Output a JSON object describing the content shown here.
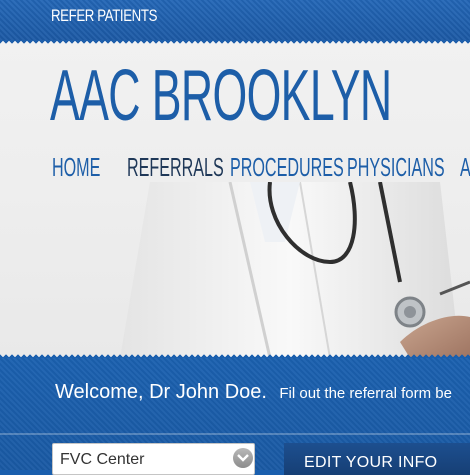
{
  "topbar": {
    "refer_label": "REFER PATIENTS"
  },
  "header": {
    "title": "AAC BROOKLYN",
    "nav": [
      {
        "label": "HOME"
      },
      {
        "label": "REFERRALS"
      },
      {
        "label": "PROCEDURES"
      },
      {
        "label": "PHYSICIANS"
      },
      {
        "label": "A"
      }
    ]
  },
  "welcome": {
    "greeting": "Welcome, Dr John Doe.",
    "instruction": "Fil out the referral form be"
  },
  "controls": {
    "center_select_value": "FVC Center",
    "edit_button_label": "EDIT YOUR INFO"
  },
  "colors": {
    "brand_blue": "#1d5ea8",
    "nav_active": "#1f3858",
    "band_blue": "#1a5fae"
  }
}
